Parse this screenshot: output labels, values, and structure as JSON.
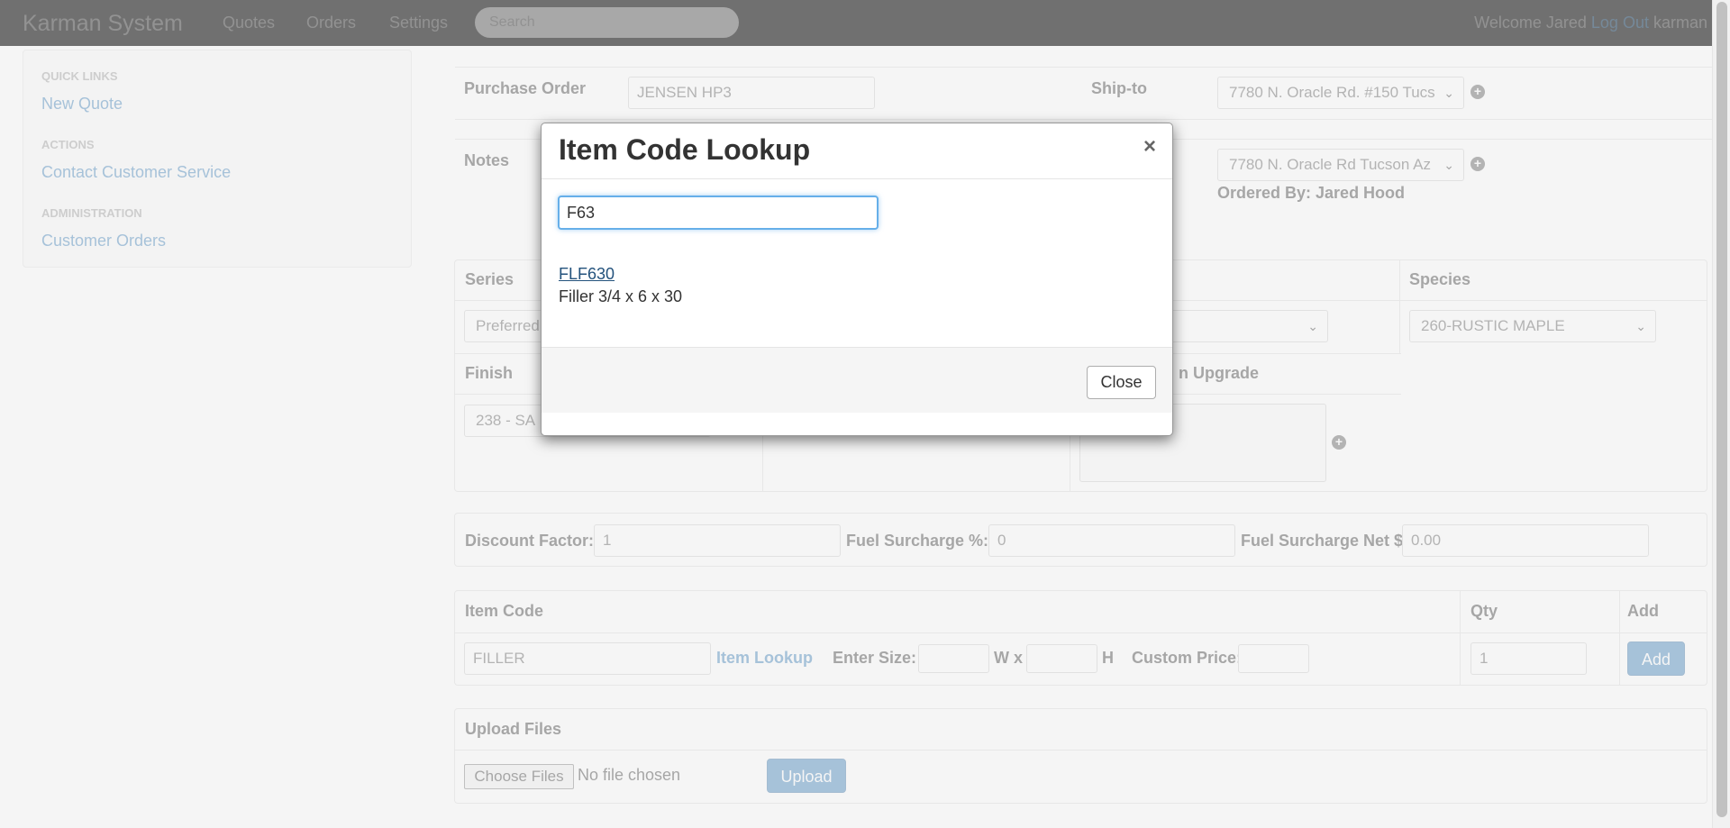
{
  "navbar": {
    "brand": "Karman System",
    "links": [
      "Quotes",
      "Orders",
      "Settings"
    ],
    "search_placeholder": "Search",
    "welcome": "Welcome Jared",
    "logout": "Log Out",
    "username": "karman"
  },
  "sidebar": {
    "quick_links_heading": "QUICK LINKS",
    "new_quote": "New Quote",
    "actions_heading": "ACTIONS",
    "contact": "Contact Customer Service",
    "admin_heading": "ADMINISTRATION",
    "customer_orders": "Customer Orders"
  },
  "order": {
    "po_label": "Purchase Order",
    "po_value": "JENSEN HP3",
    "shipto_label": "Ship-to",
    "shipto_value": "7780 N. Oracle Rd. #150 Tucs",
    "notes_label": "Notes",
    "billto_value": "7780 N. Oracle Rd Tucson Az",
    "ordered_by": "Ordered By: Jared Hood"
  },
  "specs": {
    "series_label": "Series",
    "series_value": "Preferred",
    "species_label": "Species",
    "species_value": "260-RUSTIC MAPLE",
    "finish_label": "Finish",
    "finish_value": "238 - SA",
    "upgrade_label": "n Upgrade"
  },
  "pricing": {
    "discount_label": "Discount Factor:",
    "discount_value": "1",
    "fuel_pct_label": "Fuel Surcharge %:",
    "fuel_pct_value": "0",
    "fuel_net_label": "Fuel Surcharge Net $",
    "fuel_net_value": "0.00"
  },
  "item_entry": {
    "item_code_label": "Item Code",
    "qty_label": "Qty",
    "add_label": "Add",
    "item_code_value": "FILLER",
    "item_lookup": "Item Lookup",
    "enter_size": "Enter Size:",
    "w_label": "W x",
    "h_label": "H",
    "custom_price": "Custom Price:",
    "qty_value": "1",
    "add_button": "Add"
  },
  "upload": {
    "label": "Upload Files",
    "choose": "Choose Files",
    "no_file": "No file chosen",
    "upload_button": "Upload"
  },
  "modal": {
    "title": "Item Code Lookup",
    "close_x": "×",
    "search_value": "F63",
    "results": [
      {
        "code": "FLF630",
        "description": "Filler 3/4 x 6 x 30"
      }
    ],
    "close_button": "Close"
  }
}
